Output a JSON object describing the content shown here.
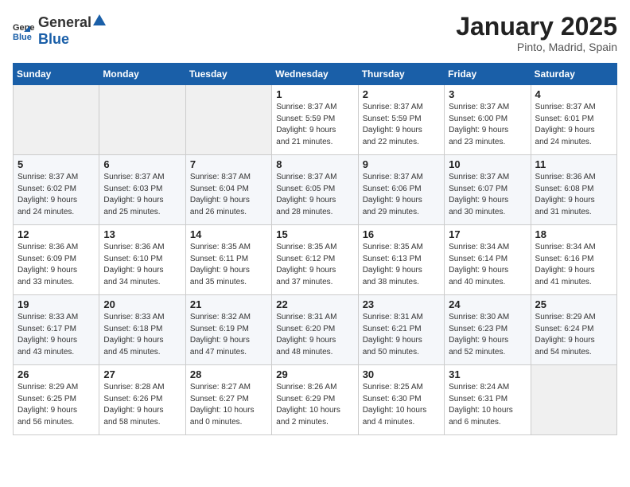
{
  "header": {
    "logo_general": "General",
    "logo_blue": "Blue",
    "title": "January 2025",
    "subtitle": "Pinto, Madrid, Spain"
  },
  "days_of_week": [
    "Sunday",
    "Monday",
    "Tuesday",
    "Wednesday",
    "Thursday",
    "Friday",
    "Saturday"
  ],
  "weeks": [
    [
      {
        "day": "",
        "info": ""
      },
      {
        "day": "",
        "info": ""
      },
      {
        "day": "",
        "info": ""
      },
      {
        "day": "1",
        "info": "Sunrise: 8:37 AM\nSunset: 5:59 PM\nDaylight: 9 hours\nand 21 minutes."
      },
      {
        "day": "2",
        "info": "Sunrise: 8:37 AM\nSunset: 5:59 PM\nDaylight: 9 hours\nand 22 minutes."
      },
      {
        "day": "3",
        "info": "Sunrise: 8:37 AM\nSunset: 6:00 PM\nDaylight: 9 hours\nand 23 minutes."
      },
      {
        "day": "4",
        "info": "Sunrise: 8:37 AM\nSunset: 6:01 PM\nDaylight: 9 hours\nand 24 minutes."
      }
    ],
    [
      {
        "day": "5",
        "info": "Sunrise: 8:37 AM\nSunset: 6:02 PM\nDaylight: 9 hours\nand 24 minutes."
      },
      {
        "day": "6",
        "info": "Sunrise: 8:37 AM\nSunset: 6:03 PM\nDaylight: 9 hours\nand 25 minutes."
      },
      {
        "day": "7",
        "info": "Sunrise: 8:37 AM\nSunset: 6:04 PM\nDaylight: 9 hours\nand 26 minutes."
      },
      {
        "day": "8",
        "info": "Sunrise: 8:37 AM\nSunset: 6:05 PM\nDaylight: 9 hours\nand 28 minutes."
      },
      {
        "day": "9",
        "info": "Sunrise: 8:37 AM\nSunset: 6:06 PM\nDaylight: 9 hours\nand 29 minutes."
      },
      {
        "day": "10",
        "info": "Sunrise: 8:37 AM\nSunset: 6:07 PM\nDaylight: 9 hours\nand 30 minutes."
      },
      {
        "day": "11",
        "info": "Sunrise: 8:36 AM\nSunset: 6:08 PM\nDaylight: 9 hours\nand 31 minutes."
      }
    ],
    [
      {
        "day": "12",
        "info": "Sunrise: 8:36 AM\nSunset: 6:09 PM\nDaylight: 9 hours\nand 33 minutes."
      },
      {
        "day": "13",
        "info": "Sunrise: 8:36 AM\nSunset: 6:10 PM\nDaylight: 9 hours\nand 34 minutes."
      },
      {
        "day": "14",
        "info": "Sunrise: 8:35 AM\nSunset: 6:11 PM\nDaylight: 9 hours\nand 35 minutes."
      },
      {
        "day": "15",
        "info": "Sunrise: 8:35 AM\nSunset: 6:12 PM\nDaylight: 9 hours\nand 37 minutes."
      },
      {
        "day": "16",
        "info": "Sunrise: 8:35 AM\nSunset: 6:13 PM\nDaylight: 9 hours\nand 38 minutes."
      },
      {
        "day": "17",
        "info": "Sunrise: 8:34 AM\nSunset: 6:14 PM\nDaylight: 9 hours\nand 40 minutes."
      },
      {
        "day": "18",
        "info": "Sunrise: 8:34 AM\nSunset: 6:16 PM\nDaylight: 9 hours\nand 41 minutes."
      }
    ],
    [
      {
        "day": "19",
        "info": "Sunrise: 8:33 AM\nSunset: 6:17 PM\nDaylight: 9 hours\nand 43 minutes."
      },
      {
        "day": "20",
        "info": "Sunrise: 8:33 AM\nSunset: 6:18 PM\nDaylight: 9 hours\nand 45 minutes."
      },
      {
        "day": "21",
        "info": "Sunrise: 8:32 AM\nSunset: 6:19 PM\nDaylight: 9 hours\nand 47 minutes."
      },
      {
        "day": "22",
        "info": "Sunrise: 8:31 AM\nSunset: 6:20 PM\nDaylight: 9 hours\nand 48 minutes."
      },
      {
        "day": "23",
        "info": "Sunrise: 8:31 AM\nSunset: 6:21 PM\nDaylight: 9 hours\nand 50 minutes."
      },
      {
        "day": "24",
        "info": "Sunrise: 8:30 AM\nSunset: 6:23 PM\nDaylight: 9 hours\nand 52 minutes."
      },
      {
        "day": "25",
        "info": "Sunrise: 8:29 AM\nSunset: 6:24 PM\nDaylight: 9 hours\nand 54 minutes."
      }
    ],
    [
      {
        "day": "26",
        "info": "Sunrise: 8:29 AM\nSunset: 6:25 PM\nDaylight: 9 hours\nand 56 minutes."
      },
      {
        "day": "27",
        "info": "Sunrise: 8:28 AM\nSunset: 6:26 PM\nDaylight: 9 hours\nand 58 minutes."
      },
      {
        "day": "28",
        "info": "Sunrise: 8:27 AM\nSunset: 6:27 PM\nDaylight: 10 hours\nand 0 minutes."
      },
      {
        "day": "29",
        "info": "Sunrise: 8:26 AM\nSunset: 6:29 PM\nDaylight: 10 hours\nand 2 minutes."
      },
      {
        "day": "30",
        "info": "Sunrise: 8:25 AM\nSunset: 6:30 PM\nDaylight: 10 hours\nand 4 minutes."
      },
      {
        "day": "31",
        "info": "Sunrise: 8:24 AM\nSunset: 6:31 PM\nDaylight: 10 hours\nand 6 minutes."
      },
      {
        "day": "",
        "info": ""
      }
    ]
  ]
}
